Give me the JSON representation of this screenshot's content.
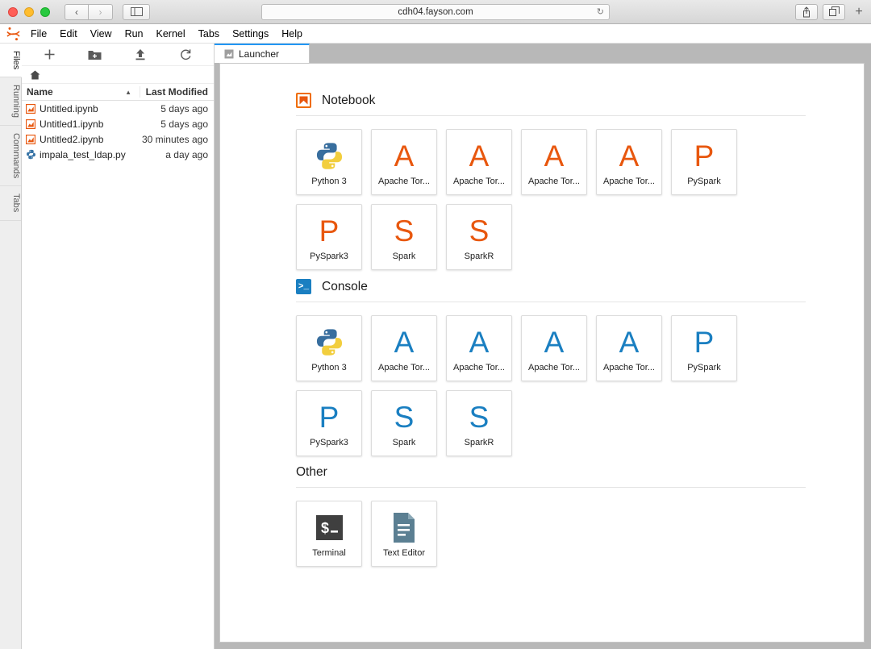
{
  "browser": {
    "url": "cdh04.fayson.com",
    "back_label": "‹",
    "forward_label": "›",
    "sidebar_icon": "sidebar-icon",
    "reload_icon": "↻",
    "share_icon": "share-icon",
    "tabs_icon": "tabs-icon",
    "newtab_label": "+"
  },
  "menubar": {
    "items": [
      {
        "label": "File"
      },
      {
        "label": "Edit"
      },
      {
        "label": "View"
      },
      {
        "label": "Run"
      },
      {
        "label": "Kernel"
      },
      {
        "label": "Tabs"
      },
      {
        "label": "Settings"
      },
      {
        "label": "Help"
      }
    ]
  },
  "sidebar": {
    "tabs": [
      {
        "label": "Files",
        "active": true
      },
      {
        "label": "Running",
        "active": false
      },
      {
        "label": "Commands",
        "active": false
      },
      {
        "label": "Tabs",
        "active": false
      }
    ]
  },
  "filebrowser": {
    "toolbar": [
      {
        "name": "new-launcher-button",
        "glyph": "+"
      },
      {
        "name": "new-folder-button",
        "glyph": "folder-plus-icon"
      },
      {
        "name": "upload-button",
        "glyph": "upload-icon"
      },
      {
        "name": "refresh-button",
        "glyph": "↻"
      }
    ],
    "breadcrumb_home": "home-icon",
    "columns": {
      "name": "Name",
      "last_modified": "Last Modified",
      "sort_direction": "▲"
    },
    "files": [
      {
        "name": "Untitled.ipynb",
        "modified": "5 days ago",
        "icon": "notebook-icon"
      },
      {
        "name": "Untitled1.ipynb",
        "modified": "5 days ago",
        "icon": "notebook-icon"
      },
      {
        "name": "Untitled2.ipynb",
        "modified": "30 minutes ago",
        "icon": "notebook-icon"
      },
      {
        "name": "impala_test_ldap.py",
        "modified": "a day ago",
        "icon": "python-icon"
      }
    ]
  },
  "main": {
    "tab": {
      "label": "Launcher",
      "icon": "launcher-icon"
    }
  },
  "launcher": {
    "sections": [
      {
        "title": "Notebook",
        "icon": "notebook-bookmark-icon",
        "color": "#e8570e",
        "rows": [
          [
            {
              "label": "Python 3",
              "icon": "python-logo"
            },
            {
              "label": "Apache Tor...",
              "icon": "letter-A"
            },
            {
              "label": "Apache Tor...",
              "icon": "letter-A"
            },
            {
              "label": "Apache Tor...",
              "icon": "letter-A"
            },
            {
              "label": "Apache Tor...",
              "icon": "letter-A"
            },
            {
              "label": "PySpark",
              "icon": "letter-P"
            }
          ],
          [
            {
              "label": "PySpark3",
              "icon": "letter-P"
            },
            {
              "label": "Spark",
              "icon": "letter-S"
            },
            {
              "label": "SparkR",
              "icon": "letter-S"
            }
          ]
        ]
      },
      {
        "title": "Console",
        "icon": "console-prompt-icon",
        "color": "#1a7fc1",
        "rows": [
          [
            {
              "label": "Python 3",
              "icon": "python-logo"
            },
            {
              "label": "Apache Tor...",
              "icon": "letter-A"
            },
            {
              "label": "Apache Tor...",
              "icon": "letter-A"
            },
            {
              "label": "Apache Tor...",
              "icon": "letter-A"
            },
            {
              "label": "Apache Tor...",
              "icon": "letter-A"
            },
            {
              "label": "PySpark",
              "icon": "letter-P"
            }
          ],
          [
            {
              "label": "PySpark3",
              "icon": "letter-P"
            },
            {
              "label": "Spark",
              "icon": "letter-S"
            },
            {
              "label": "SparkR",
              "icon": "letter-S"
            }
          ]
        ]
      },
      {
        "title": "Other",
        "icon": "none",
        "color": "#555555",
        "rows": [
          [
            {
              "label": "Terminal",
              "icon": "terminal-icon"
            },
            {
              "label": "Text Editor",
              "icon": "text-editor-icon"
            }
          ]
        ]
      }
    ]
  },
  "colors": {
    "notebook_orange": "#e8570e",
    "console_blue": "#1a7fc1",
    "tab_accent": "#2196f3",
    "terminal_dark": "#3f3f3f",
    "editor_slate": "#5b7f92"
  }
}
